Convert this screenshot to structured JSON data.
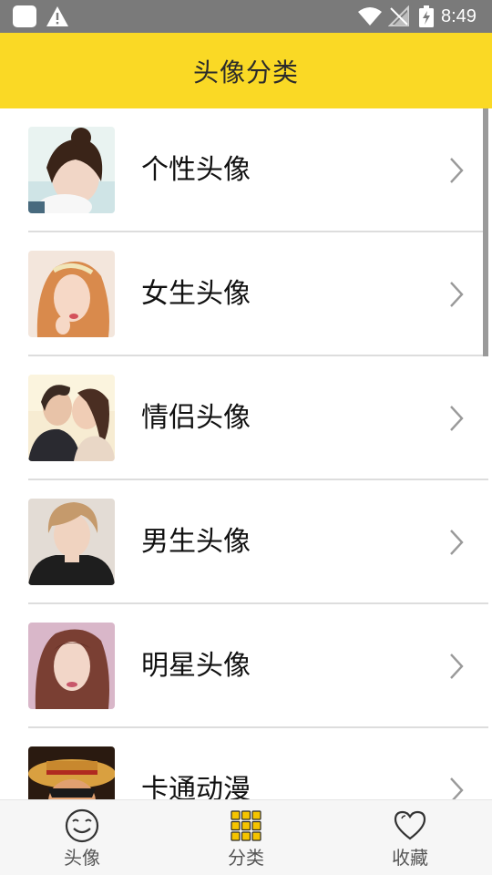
{
  "status_bar": {
    "time": "8:49",
    "icons": [
      "app-notification-icon",
      "warning-icon",
      "wifi-icon",
      "no-signal-icon",
      "battery-charging-icon"
    ]
  },
  "header": {
    "title": "头像分类",
    "background_color": "#fad925"
  },
  "categories": [
    {
      "label": "个性头像",
      "thumbnail": "girl-with-bun-photo",
      "chevron": "chevron-right-icon"
    },
    {
      "label": "女生头像",
      "thumbnail": "girl-with-flower-crown-photo",
      "chevron": "chevron-right-icon"
    },
    {
      "label": "情侣头像",
      "thumbnail": "couple-photo",
      "chevron": "chevron-right-icon"
    },
    {
      "label": "男生头像",
      "thumbnail": "young-man-photo",
      "chevron": "chevron-right-icon"
    },
    {
      "label": "明星头像",
      "thumbnail": "female-celebrity-photo",
      "chevron": "chevron-right-icon"
    },
    {
      "label": "卡通动漫",
      "thumbnail": "anime-straw-hat-character",
      "chevron": "chevron-right-icon"
    }
  ],
  "bottom_nav": {
    "items": [
      {
        "label": "头像",
        "icon": "smiley-face-icon",
        "active": false
      },
      {
        "label": "分类",
        "icon": "grid-icon",
        "active": true
      },
      {
        "label": "收藏",
        "icon": "heart-icon",
        "active": false
      }
    ],
    "active_color": "#f5c400"
  }
}
